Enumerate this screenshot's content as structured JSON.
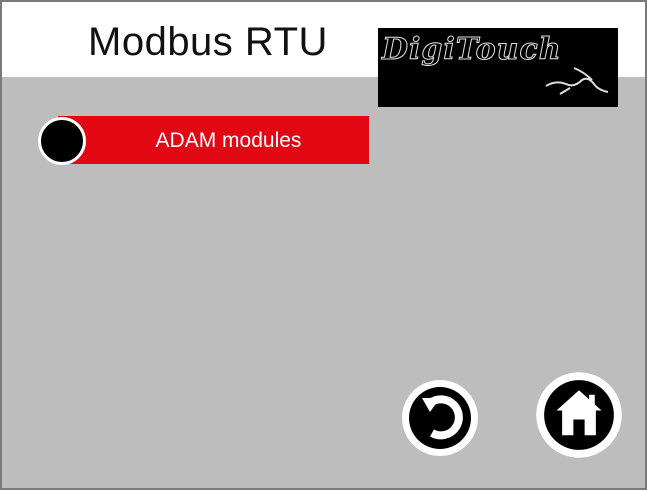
{
  "header": {
    "title": "Modbus RTU",
    "logo_text": "DigiTouch"
  },
  "menu": {
    "items": [
      {
        "label": "ADAM modules",
        "selected": true
      }
    ]
  },
  "nav": {
    "back_icon": "back-arrow-icon",
    "home_icon": "home-icon"
  },
  "colors": {
    "accent": "#e30613",
    "background": "#bdbdbd",
    "header": "#ffffff"
  }
}
